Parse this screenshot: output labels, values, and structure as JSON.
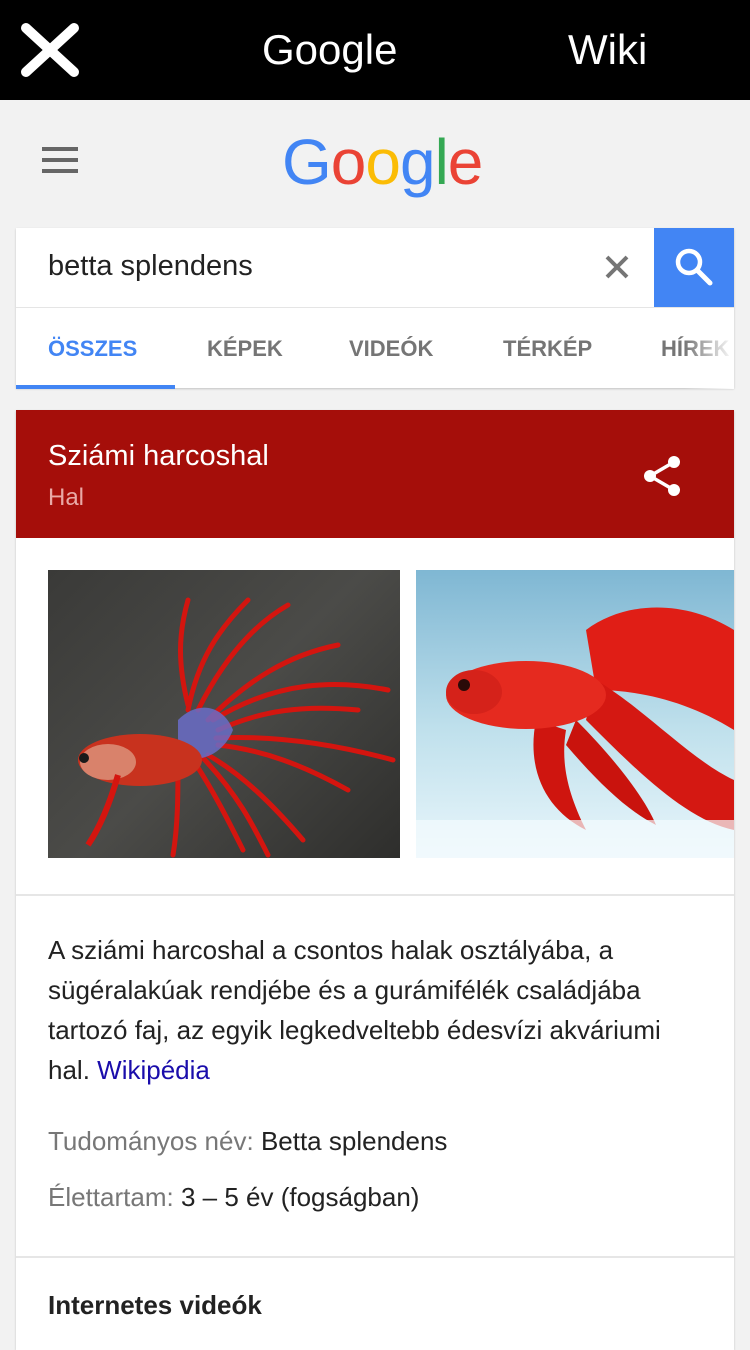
{
  "topbar": {
    "close_icon": "close-icon",
    "title": "Google",
    "wiki_label": "Wiki"
  },
  "header": {
    "menu_icon": "hamburger-menu-icon",
    "logo_letters": [
      "G",
      "o",
      "o",
      "g",
      "l",
      "e"
    ],
    "logo_colors": [
      "#4285f4",
      "#ea4335",
      "#fbbc05",
      "#4285f4",
      "#34a853",
      "#ea4335"
    ]
  },
  "search": {
    "query": "betta splendens",
    "clear_icon": "clear-icon",
    "search_icon": "search-icon",
    "accent": "#4285f4"
  },
  "tabs": [
    {
      "label": "ÖSSZES",
      "active": true
    },
    {
      "label": "KÉPEK"
    },
    {
      "label": "VIDEÓK"
    },
    {
      "label": "TÉRKÉP"
    },
    {
      "label": "HÍREK"
    }
  ],
  "knowledge_panel": {
    "title": "Sziámi harcoshal",
    "subtitle": "Hal",
    "header_color": "#a50e0a",
    "share_icon": "share-icon",
    "description": "A sziámi harcoshal a csontos halak osztályába, a sügéralakúak rendjébe és a gurámifélék családjába tartozó faj, az egyik legkedveltebb édesvízi akváriumi hal.",
    "source_link": "Wikipédia",
    "facts": [
      {
        "key": "Tudományos név:",
        "value": "Betta splendens"
      },
      {
        "key": "Élettartam:",
        "value": "3 – 5 év (fogságban)"
      }
    ],
    "videos_heading": "Internetes videók"
  }
}
